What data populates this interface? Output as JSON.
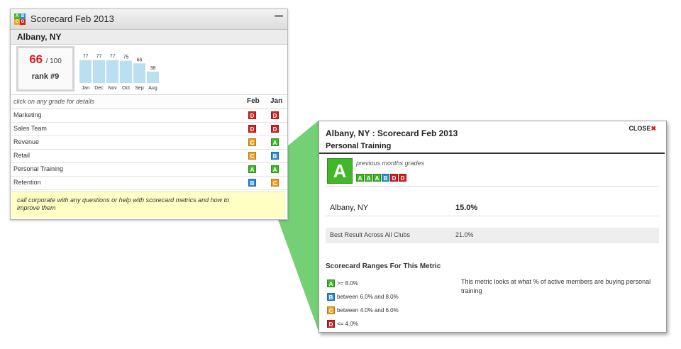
{
  "widget": {
    "title": "Scorecard Feb 2013",
    "location": "Albany, NY",
    "score": {
      "value": "66",
      "out_of": "/ 100",
      "rank": "rank #9"
    },
    "hint": "click on any grade for details",
    "columns": [
      "Feb",
      "Jan"
    ],
    "note": "call corporate with any questions or help with scorecard metrics and how to improve them"
  },
  "chart_data": {
    "type": "bar",
    "categories": [
      "Jan",
      "Dec",
      "Nov",
      "Oct",
      "Sep",
      "Aug"
    ],
    "values": [
      77,
      77,
      77,
      75,
      66,
      38
    ],
    "ylim": [
      0,
      100
    ],
    "bar_color": "#b9dff0",
    "title": "",
    "xlabel": "",
    "ylabel": ""
  },
  "metrics": [
    {
      "label": "Marketing",
      "feb": "D",
      "jan": "D"
    },
    {
      "label": "Sales Team",
      "feb": "D",
      "jan": "D"
    },
    {
      "label": "Revenue",
      "feb": "C",
      "jan": "A"
    },
    {
      "label": "Retail",
      "feb": "C",
      "jan": "B"
    },
    {
      "label": "Personal Training",
      "feb": "A",
      "jan": "A"
    },
    {
      "label": "Retention",
      "feb": "B",
      "jan": "C"
    }
  ],
  "grade_colors": {
    "A": "#41b828",
    "B": "#2a8fd6",
    "C": "#f0a020",
    "D": "#d42020"
  },
  "popup": {
    "title": "Albany, NY : Scorecard Feb 2013",
    "close_label": "CLOSE",
    "close_icon": "✖",
    "metric_name": "Personal Training",
    "current_grade": "A",
    "previous_label": "previous months grades",
    "previous_grades": [
      "A",
      "A",
      "A",
      "B",
      "D",
      "D"
    ],
    "results": [
      {
        "label": "Albany, NY",
        "value": "15.0%"
      },
      {
        "label": "Best Result Across All Clubs",
        "value": "21.0%"
      }
    ],
    "ranges_title": "Scorecard Ranges For This Metric",
    "ranges": [
      {
        "grade": "A",
        "text": ">= 8.0%"
      },
      {
        "grade": "B",
        "text": "between 6.0% and 8.0%"
      },
      {
        "grade": "C",
        "text": "between 4.0% and 6.0%"
      },
      {
        "grade": "D",
        "text": "<= 4.0%"
      }
    ],
    "description": "This metric looks at what % of active members are buying personal training"
  }
}
